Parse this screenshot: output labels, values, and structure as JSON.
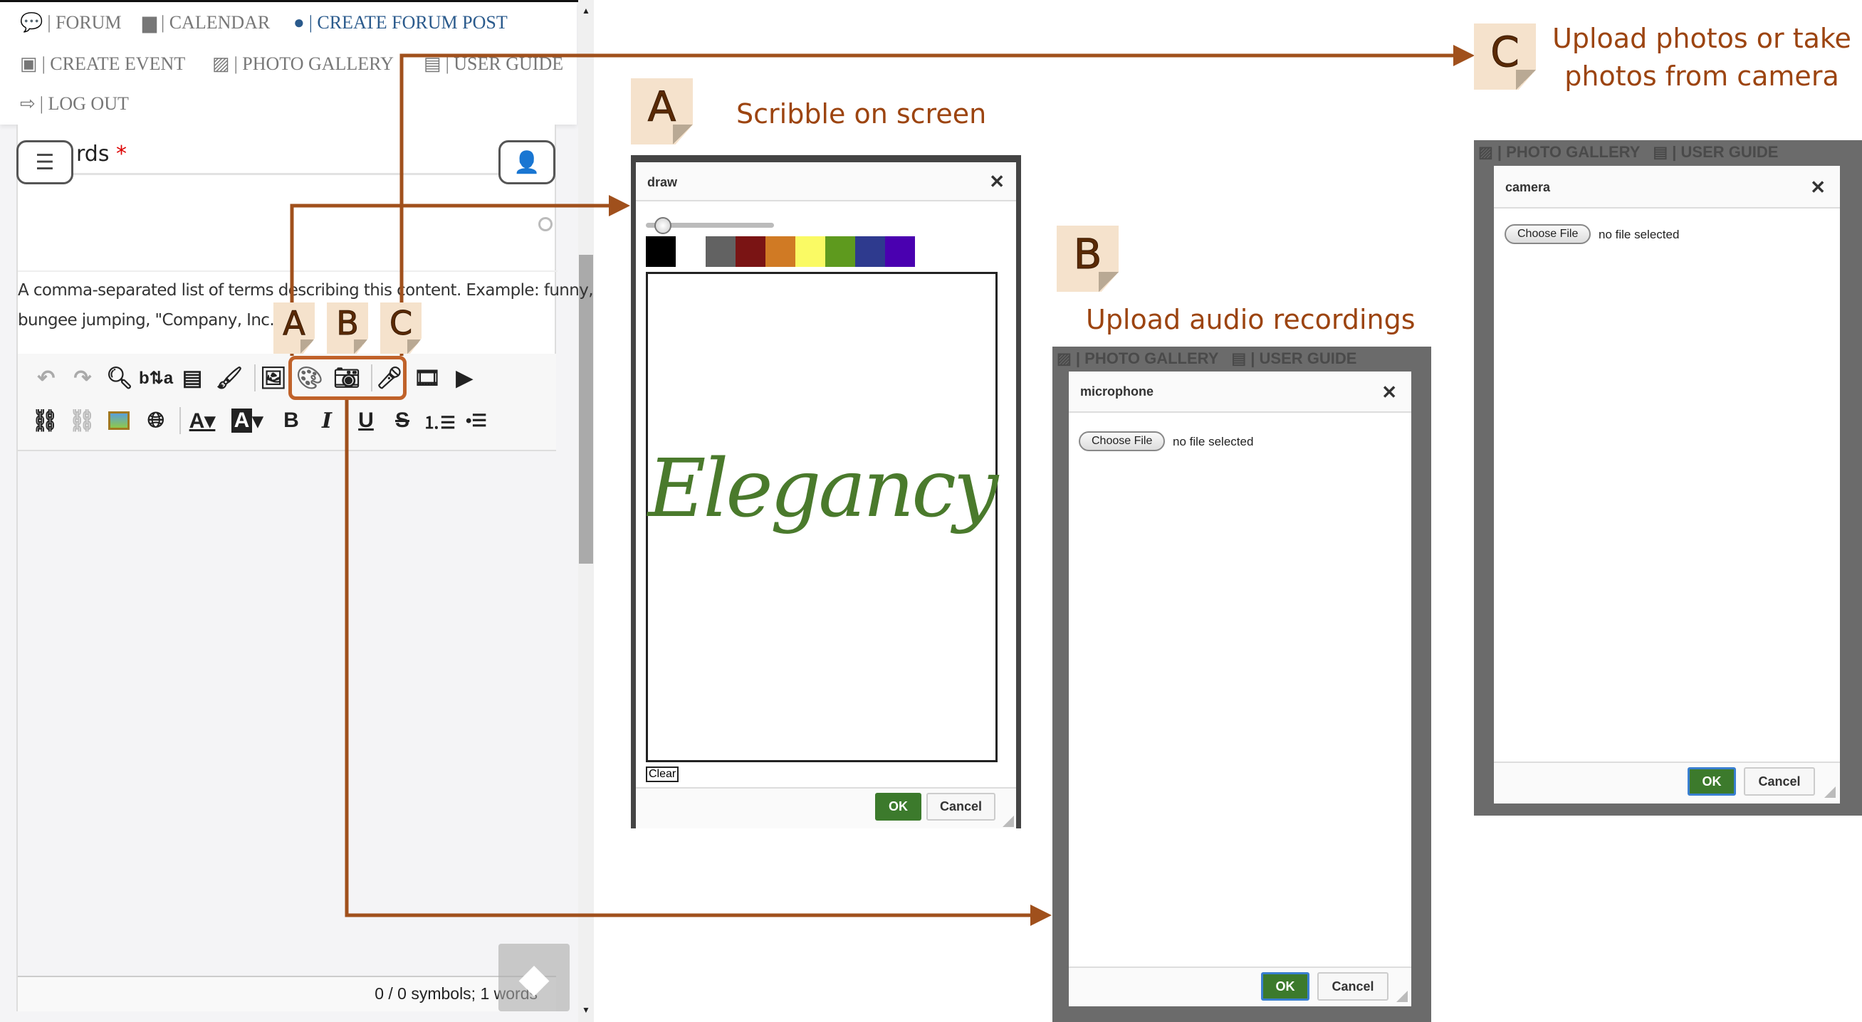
{
  "nav": {
    "items": [
      {
        "label": "| FORUM",
        "icon": "comments-icon"
      },
      {
        "label": "| CALENDAR",
        "icon": "calendar-icon"
      },
      {
        "label": "| CREATE FORUM POST",
        "icon": "comment-dots-icon",
        "active": true
      },
      {
        "label": "| CREATE EVENT",
        "icon": "calendar-plus-icon"
      },
      {
        "label": "| PHOTO GALLERY",
        "icon": "image-icon"
      },
      {
        "label": "| USER GUIDE",
        "icon": "book-icon"
      },
      {
        "label": "| LOG OUT",
        "icon": "sign-out-icon"
      }
    ]
  },
  "form": {
    "field_label": "rds",
    "required_mark": "*",
    "help_line1": "A comma-separated list of terms describing this content. Example: funny,",
    "help_line2": "bungee jumping, \"Company, Inc.\".",
    "status": "0 / 0 symbols; 1 words"
  },
  "toolbar": {
    "row1": [
      "undo-icon",
      "redo-icon",
      "search-icon",
      "replace-icon",
      "template-icon",
      "format-painter-icon",
      "image-icon",
      "draw-palette-icon",
      "camera-icon",
      "microphone-icon",
      "video-icon",
      "youtube-icon"
    ],
    "row2": [
      "link-icon",
      "unlink-icon",
      "picture-icon",
      "globe-icon",
      "font-color-icon",
      "background-color-icon",
      "bold-icon",
      "italic-icon",
      "underline-icon",
      "strikethrough-icon",
      "numbered-list-icon",
      "bullet-list-icon"
    ]
  },
  "callouts": {
    "a": {
      "letter": "A",
      "caption": "Scribble on screen"
    },
    "b": {
      "letter": "B",
      "caption": "Upload audio recordings"
    },
    "c": {
      "letter": "C",
      "caption_line1": "Upload photos or take",
      "caption_line2": "photos from camera"
    }
  },
  "draw_dialog": {
    "title": "draw",
    "brush_size": 0.1,
    "swatches": [
      "#000000",
      "#ffffff",
      "#626262",
      "#7a1414",
      "#d07a24",
      "#fafa64",
      "#5e9a1e",
      "#2e3a8e",
      "#4a00b0"
    ],
    "drawing_text": "Elegancy",
    "drawing_color": "#4a7a2c",
    "clear_label": "Clear",
    "ok_label": "OK",
    "cancel_label": "Cancel"
  },
  "mic_dialog": {
    "backdrop_text1": "| PHOTO GALLERY",
    "backdrop_text2": "| USER GUIDE",
    "title": "microphone",
    "choose_label": "Choose File",
    "file_status": "no file selected",
    "ok_label": "OK",
    "cancel_label": "Cancel"
  },
  "camera_dialog": {
    "backdrop_text1": "| PHOTO GALLERY",
    "backdrop_text2": "| USER GUIDE",
    "title": "camera",
    "choose_label": "Choose File",
    "file_status": "no file selected",
    "ok_label": "OK",
    "cancel_label": "Cancel"
  },
  "colors": {
    "accent": "#a0501c",
    "highlight": "#c0622a",
    "ok": "#3c7a2c",
    "nav_active": "#2a5a8c"
  }
}
